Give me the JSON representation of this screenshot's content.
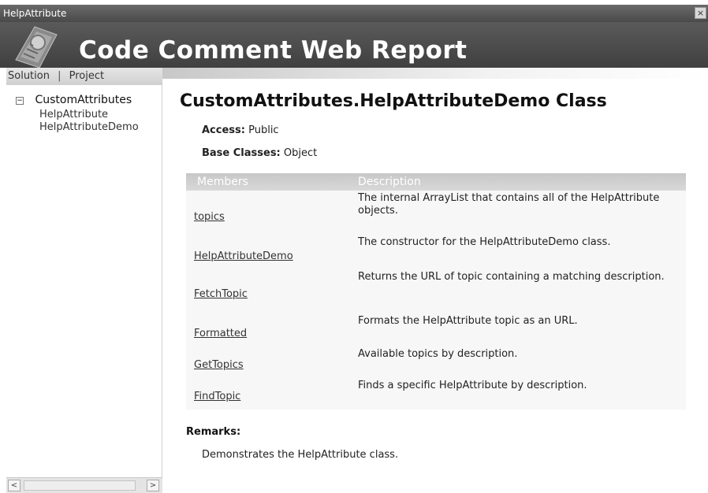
{
  "window": {
    "title": "HelpAttribute",
    "close_glyph": "×"
  },
  "banner": {
    "title": "Code Comment Web Report",
    "logo_icon": "report-logo-icon"
  },
  "left_panel": {
    "tabs": [
      "Solution",
      "Project"
    ],
    "separator": "|",
    "tree": {
      "root_toggle": "−",
      "root_label": "CustomAttributes",
      "children": [
        "HelpAttribute",
        "HelpAttributeDemo"
      ]
    },
    "scroll": {
      "left": "<",
      "right": ">"
    }
  },
  "main": {
    "title": "CustomAttributes.HelpAttributeDemo Class",
    "access_label": "Access:",
    "access_value": "Public",
    "base_label": "Base Classes:",
    "base_value": "Object",
    "table": {
      "headers": [
        "Members",
        "Description"
      ],
      "rows": [
        {
          "member": "topics",
          "description": "The internal ArrayList that contains all of the HelpAttribute objects."
        },
        {
          "member": "HelpAttributeDemo",
          "description": "The constructor for the HelpAttributeDemo class."
        },
        {
          "member": "FetchTopic",
          "description": "Returns the URL of topic containing a matching description."
        },
        {
          "member": "Formatted",
          "description": "Formats the HelpAttribute topic as an URL."
        },
        {
          "member": "GetTopics",
          "description": "Available topics by description."
        },
        {
          "member": "FindTopic",
          "description": "Finds a specific HelpAttribute by description."
        }
      ]
    },
    "remarks_label": "Remarks:",
    "remarks_text": "Demonstrates the HelpAttribute class."
  }
}
